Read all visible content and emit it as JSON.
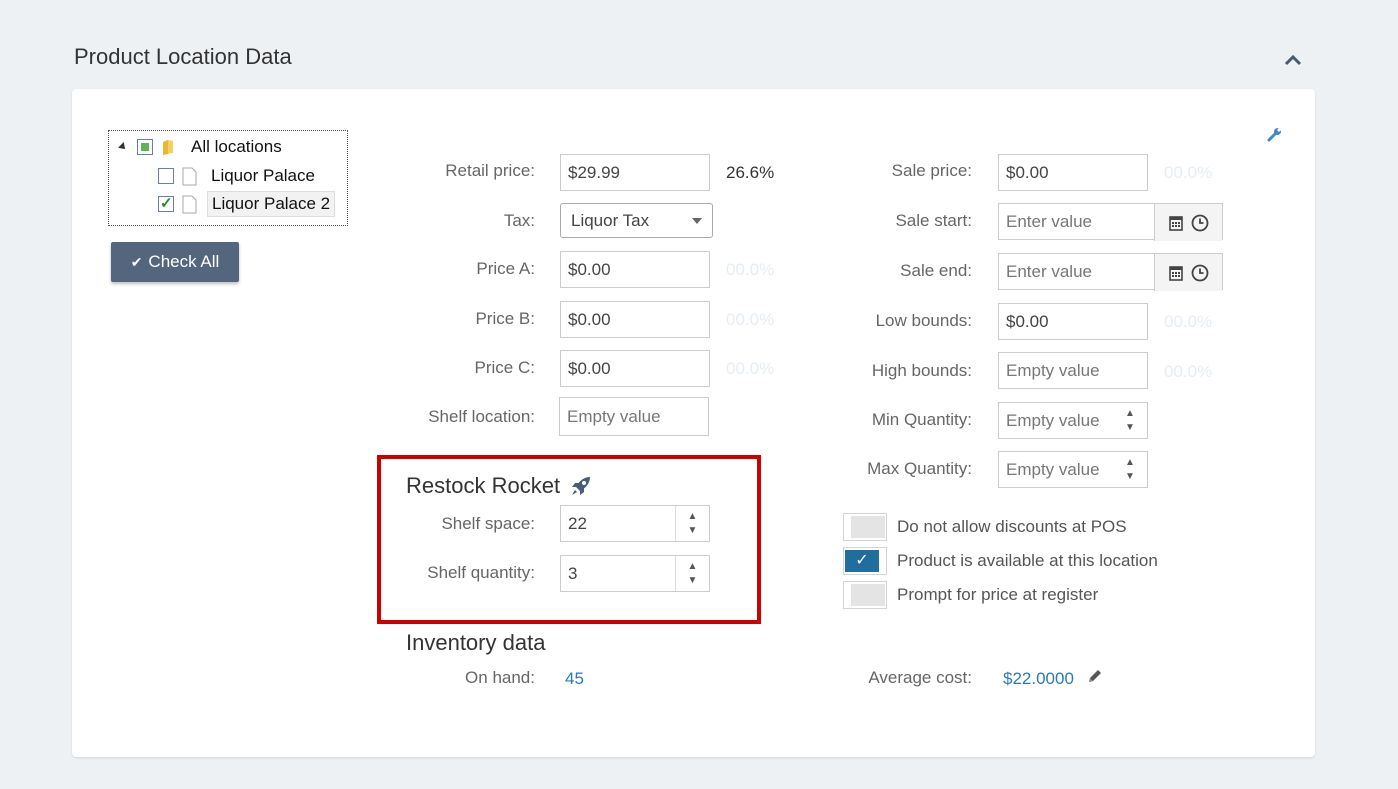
{
  "section": {
    "title": "Product Location Data",
    "collapse_icon": "chevron-up-icon"
  },
  "tree": {
    "root": {
      "label": "All locations",
      "state": "partial"
    },
    "children": [
      {
        "label": "Liquor Palace",
        "checked": false
      },
      {
        "label": "Liquor Palace 2",
        "checked": true
      }
    ],
    "check_all_label": "Check All"
  },
  "pricing": {
    "retail_label": "Retail price:",
    "retail_value": "$29.99",
    "retail_pct": "26.6%",
    "tax_label": "Tax:",
    "tax_value": "Liquor Tax",
    "price_a_label": "Price A:",
    "price_a_value": "$0.00",
    "price_a_pct": "00.0%",
    "price_b_label": "Price B:",
    "price_b_value": "$0.00",
    "price_b_pct": "00.0%",
    "price_c_label": "Price C:",
    "price_c_value": "$0.00",
    "price_c_pct": "00.0%",
    "shelf_location_label": "Shelf location:",
    "shelf_location_placeholder": "Empty value"
  },
  "sale": {
    "sale_price_label": "Sale price:",
    "sale_price_value": "$0.00",
    "sale_price_pct": "00.0%",
    "sale_start_label": "Sale start:",
    "sale_start_placeholder": "Enter value",
    "sale_end_label": "Sale end:",
    "sale_end_placeholder": "Enter value",
    "low_bounds_label": "Low bounds:",
    "low_bounds_value": "$0.00",
    "low_bounds_pct": "00.0%",
    "high_bounds_label": "High bounds:",
    "high_bounds_placeholder": "Empty value",
    "high_bounds_pct": "00.0%",
    "min_qty_label": "Min Quantity:",
    "min_qty_placeholder": "Empty value",
    "max_qty_label": "Max Quantity:",
    "max_qty_placeholder": "Empty value"
  },
  "restock": {
    "title": "Restock Rocket",
    "shelf_space_label": "Shelf space:",
    "shelf_space_value": "22",
    "shelf_quantity_label": "Shelf quantity:",
    "shelf_quantity_value": "3"
  },
  "options": [
    {
      "label": "Do not allow discounts at POS",
      "on": false
    },
    {
      "label": "Product is available at this location",
      "on": true
    },
    {
      "label": "Prompt for price at register",
      "on": false
    }
  ],
  "inventory": {
    "title": "Inventory data",
    "on_hand_label": "On hand:",
    "on_hand_value": "45",
    "avg_cost_label": "Average cost:",
    "avg_cost_value": "$22.0000"
  },
  "colors": {
    "accent": "#2a7ab8",
    "highlight_border": "#cc0000",
    "button": "#54657e"
  }
}
